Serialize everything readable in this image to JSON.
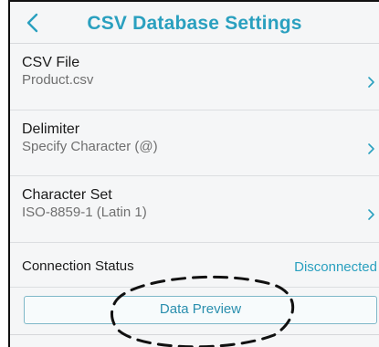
{
  "header": {
    "title": "CSV Database Settings",
    "back_icon": "chevron-left-icon"
  },
  "settings": [
    {
      "label": "CSV File",
      "value": "Product.csv"
    },
    {
      "label": "Delimiter",
      "value": "Specify Character (@)"
    },
    {
      "label": "Character Set",
      "value": "ISO-8859-1 (Latin 1)"
    }
  ],
  "connection": {
    "label": "Connection Status",
    "value": "Disconnected"
  },
  "preview_button": {
    "label": "Data Preview"
  },
  "colors": {
    "accent": "#2aa0bf",
    "background": "#f5f6f7",
    "value_text": "#6f6f6f"
  }
}
